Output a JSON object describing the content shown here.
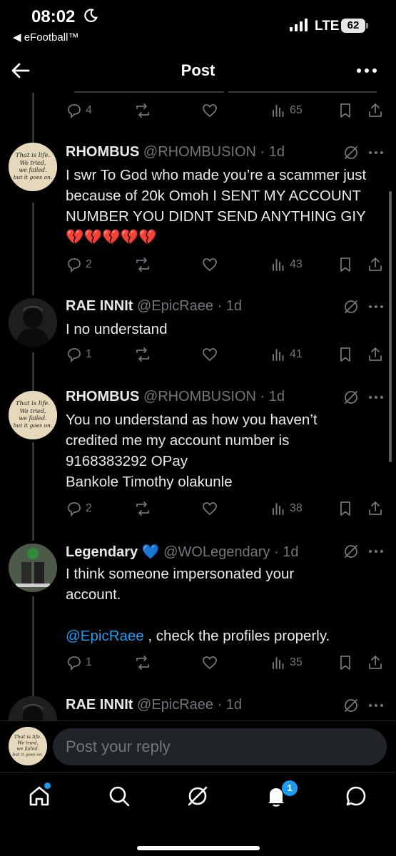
{
  "status_bar": {
    "time": "08:02",
    "back_app": "◀ eFootball™",
    "network": "LTE",
    "battery": "62"
  },
  "header": {
    "title": "Post"
  },
  "parent_post": {
    "replies": "4",
    "views": "65"
  },
  "replies": [
    {
      "name": "RHOMBUS",
      "handle": "@RHOMBUSION · 1d",
      "text": "I swr To God who made you’re a scammer just because of 20k Omoh I SENT MY ACCOUNT NUMBER YOU DIDNT SEND ANYTHING GIY 💔💔💔💔💔",
      "replies": "2",
      "views": "43",
      "avatar_text": "That is life. We tried, we failed. but it goes on."
    },
    {
      "name": "RAE INNIt",
      "handle": "@EpicRaee · 1d",
      "text": "I no understand",
      "replies": "1",
      "views": "41"
    },
    {
      "name": "RHOMBUS",
      "handle": "@RHOMBUSION · 1d",
      "text_lines": [
        "You no understand as how you haven’t",
        "credited me my account number is",
        "9168383292 OPay",
        "Bankole Timothy olakunle"
      ],
      "replies": "2",
      "views": "38",
      "avatar_text": "That is life. We tried, we failed. but it goes on."
    },
    {
      "name": "Legendary",
      "name_emoji": "💙",
      "handle": "@WOLegendary · 1d",
      "text_line1": "I think someone impersonated your",
      "text_line2": "account.",
      "mention": "@EpicRaee",
      "text_after_mention": " , check the profiles properly.",
      "replies": "1",
      "views": "35"
    },
    {
      "name": "RAE INNIt",
      "handle": "@EpicRaee · 1d"
    }
  ],
  "composer": {
    "placeholder": "Post your reply",
    "avatar_text": "That is life. We tried, we failed. but it goes on."
  },
  "tabbar": {
    "notifications_badge": "1"
  },
  "colors": {
    "accent": "#1d9bf0",
    "muted": "#71767b",
    "text": "#e7e9ea",
    "background": "#000000"
  }
}
